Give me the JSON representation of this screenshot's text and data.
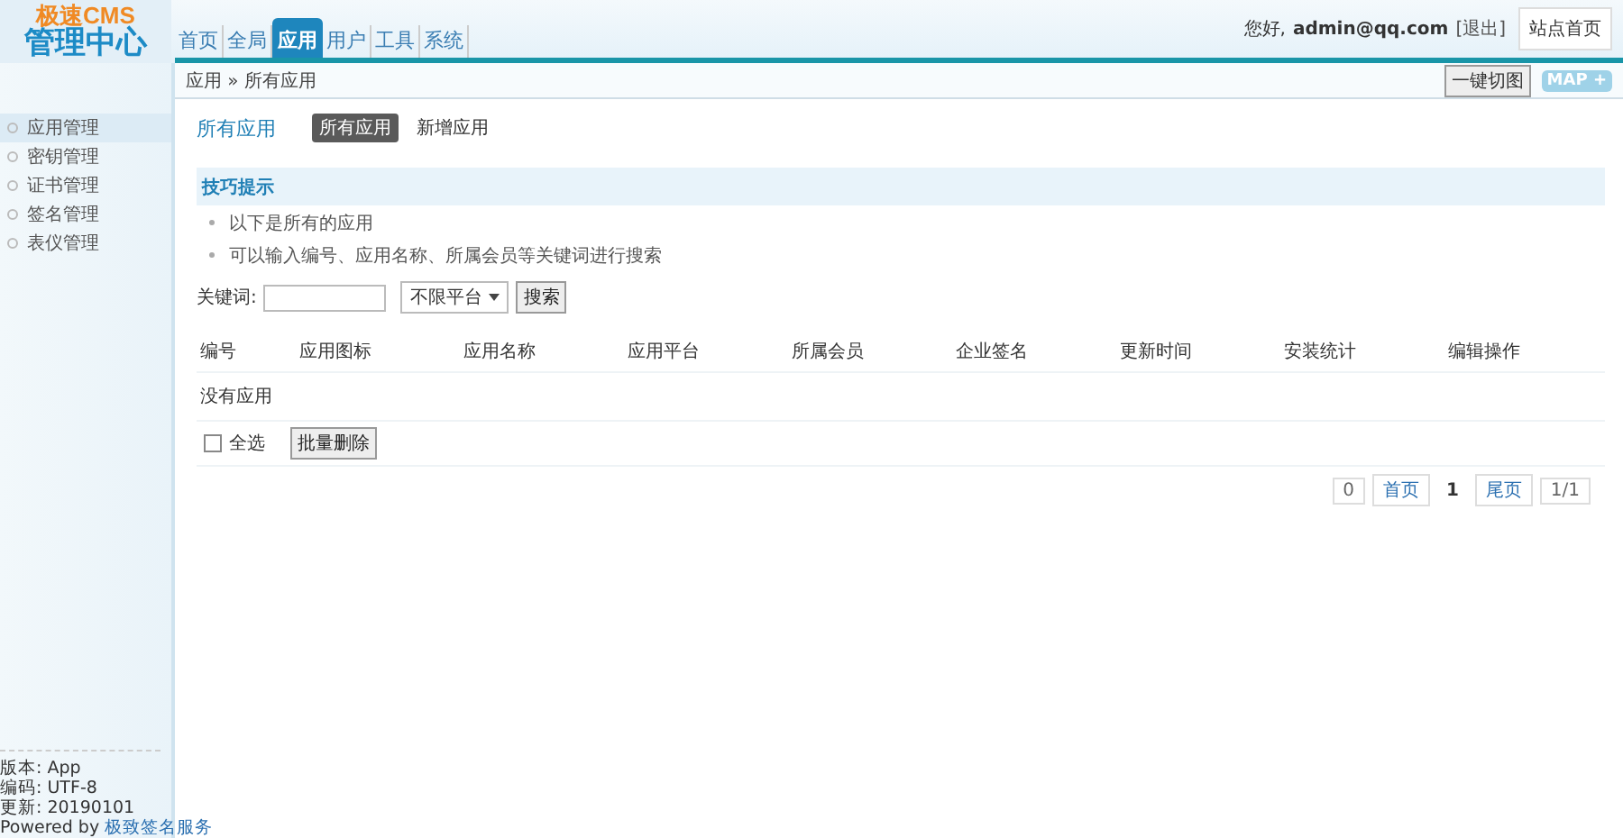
{
  "logo": {
    "line_1": "极速CMS",
    "line_2": "管理中心"
  },
  "nav_tabs": [
    {
      "label": "首页",
      "selected": false
    },
    {
      "label": "全局",
      "selected": false
    },
    {
      "label": "应用",
      "selected": true
    },
    {
      "label": "用户",
      "selected": false
    },
    {
      "label": "工具",
      "selected": false
    },
    {
      "label": "系统",
      "selected": false
    }
  ],
  "user_bar": {
    "greeting": "您好,",
    "user": "admin@qq.com",
    "logout": "[退出]",
    "home_button": "站点首页"
  },
  "breadcrumb": "应用 » 所有应用",
  "toolbar_buttons": [
    {
      "label": "一键切图",
      "kind": "plain"
    },
    {
      "label": "MAP +",
      "kind": "map"
    }
  ],
  "sidebar": {
    "items": [
      {
        "label": "应用管理",
        "selected": true
      },
      {
        "label": "密钥管理",
        "selected": false
      },
      {
        "label": "证书管理",
        "selected": false
      },
      {
        "label": "签名管理",
        "selected": false
      },
      {
        "label": "表仪管理",
        "selected": false
      }
    ],
    "footer": [
      "版本: App",
      "编码: UTF-8",
      "更新: 20190101"
    ],
    "powered": {
      "prefix": "Powered by",
      "link": "极致签名服务"
    }
  },
  "page_title": "所有应用",
  "sub_tabs": [
    {
      "label": "所有应用",
      "selected": true
    },
    {
      "label": "新增应用",
      "selected": false
    }
  ],
  "tips": {
    "title": "技巧提示",
    "items": [
      "以下是所有的应用",
      "可以输入编号、应用名称、所属会员等关键词进行搜索"
    ]
  },
  "search": {
    "label": "关键词:",
    "platform": "不限平台",
    "button": "搜索"
  },
  "table": {
    "columns": [
      "编号",
      "应用图标",
      "应用名称",
      "应用平台",
      "所属会员",
      "企业签名",
      "更新时间",
      "安装统计",
      "编辑操作"
    ],
    "empty": "没有应用"
  },
  "batch": {
    "select_all": {
      "label": "全选",
      "checked": false
    },
    "delete_button": "批量删除"
  },
  "pagination": [
    {
      "label": "0",
      "kind": "count"
    },
    {
      "label": "首页",
      "kind": "link"
    },
    {
      "label": "1",
      "kind": "current"
    },
    {
      "label": "尾页",
      "kind": "link"
    },
    {
      "label": "1/1",
      "kind": "count"
    }
  ]
}
